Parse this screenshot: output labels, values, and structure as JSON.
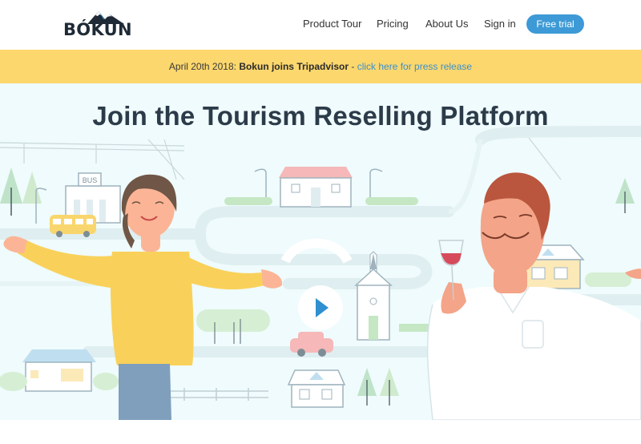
{
  "brand": {
    "name": "BÓKUN"
  },
  "nav": {
    "items": [
      "Product Tour",
      "Pricing",
      "About Us",
      "Sign in"
    ],
    "cta": "Free trial"
  },
  "banner": {
    "date": "April 20th 2018:",
    "headline": "Bokun joins Tripadvisor",
    "separator": "-",
    "link": "click here for press release"
  },
  "hero": {
    "title": "Join the Tourism Reselling Platform",
    "bus_sign": "BUS"
  },
  "colors": {
    "accent": "#3d9ad6",
    "banner": "#fcd76d",
    "hero_bg": "#effbfc",
    "title": "#2c3b49"
  },
  "icons": [
    "mountain-logo-icon",
    "play-icon"
  ]
}
